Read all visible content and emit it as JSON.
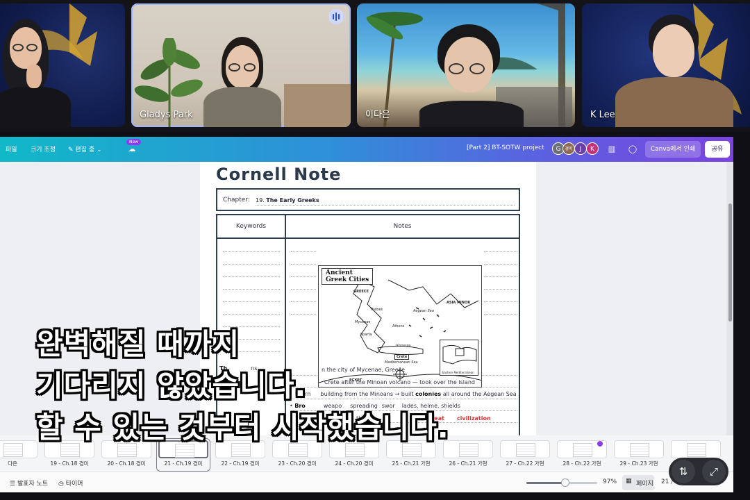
{
  "participants": [
    {
      "name": ""
    },
    {
      "name": "Gladys Park"
    },
    {
      "name": "이다은"
    },
    {
      "name": "K Lee"
    }
  ],
  "toolbar": {
    "file": "파일",
    "resize": "크기 조정",
    "editing": "편집 중",
    "new_badge": "New",
    "project_title": "[Part 2] BT-SOTW project",
    "avatars": [
      "G",
      "경미",
      "J",
      "K"
    ],
    "print_button": "Canva에서 인쇄",
    "share_button": "공유"
  },
  "document": {
    "title": "Cornell Note",
    "chapter_label": "Chapter:",
    "chapter_number": "19.",
    "chapter_name": "The Early Greeks",
    "col_keywords": "Keywords",
    "col_notes": "Notes",
    "map": {
      "title_line1": "Ancient",
      "title_line2": "Greek Cities",
      "labels": [
        "GREECE",
        "ASIA MINOR",
        "Aegean Sea",
        "Crete",
        "Mediterranean Sea",
        "EGYPT",
        "Thebes",
        "Athens",
        "Mycenae",
        "Sparta",
        "Knossos",
        "Eastern Mediterranean"
      ]
    },
    "notes": [
      "n the city of Mycenae, Greece",
      "Crete after the Minoan volcano — took over the island",
      "Learn",
      "building from the Minoans → built",
      "colonies",
      "all around the Aegean Sea",
      "Bro",
      "weapo",
      "spreading",
      "swor",
      "lades, helme",
      "shields",
      "tle",
      "eat",
      "civilization"
    ],
    "keywords_partial": "Th",
    "keywords_partial2": "ns"
  },
  "thumbnails": [
    {
      "label": "다은"
    },
    {
      "label": "19 - Ch.18 경미"
    },
    {
      "label": "20 - Ch.18 경미"
    },
    {
      "label": "21 - Ch.19 경미",
      "selected": true
    },
    {
      "label": "22 - Ch.19 경미"
    },
    {
      "label": "23 - Ch.20 경미"
    },
    {
      "label": "24 - Ch.20 경미"
    },
    {
      "label": "25 - Ch.21 가현"
    },
    {
      "label": "26 - Ch.21 가현"
    },
    {
      "label": "27 - Ch.22 가현"
    },
    {
      "label": "28 - Ch.22 가현",
      "dot": true
    },
    {
      "label": "29 - Ch.23 가현"
    },
    {
      "label": ""
    }
  ],
  "bottombar": {
    "presenter_notes": "발표자 노트",
    "timer": "타이머",
    "zoom": "97%",
    "zoom_level": 0.55,
    "page_label": "페이지",
    "page_count": "21 /"
  },
  "subtitles": [
    "완벽해질 때까지",
    "기다리지 않았습니다.",
    "할 수 있는 것부터 시작했습니다."
  ],
  "colors": {
    "toolbar_gradient_start": "#11b8c8",
    "toolbar_gradient_end": "#7a43e0",
    "accent_purple": "#8b3cf0",
    "highlight_red": "#d33333"
  }
}
